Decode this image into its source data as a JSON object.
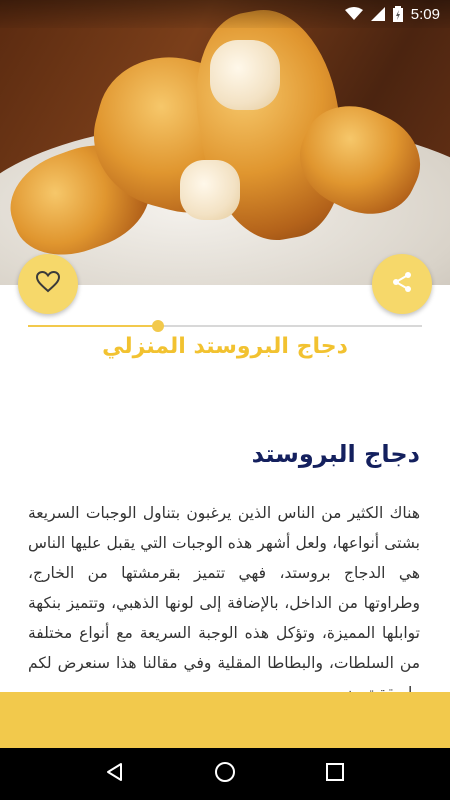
{
  "status_bar": {
    "time": "5:09",
    "icons": [
      "wifi-icon",
      "signal-icon",
      "battery-charging-icon"
    ]
  },
  "recipe": {
    "title": "دجاج البروستد المنزلي",
    "reading_progress": 0.33
  },
  "article": {
    "heading": "دجاج البروستد",
    "body": "هناك الكثير من الناس الذين يرغبون بتناول الوجبات السريعة بشتى أنواعها، ولعل أشهر هذه الوجبات التي يقبل عليها الناس هي الدجاج بروستد، فهي تتميز بقرمشتها من الخارج، وطراوتها من الداخل، بالإضافة إلى لونها الذهبي، وتتميز بنكهة توابلها المميزة، وتؤكل هذه الوجبة السريعة مع أنواع مختلفة من السلطات، والبطاطا المقلية وفي مقالنا هذا سنعرض لكم طريقة تحضير"
  },
  "actions": {
    "favorite_icon": "heart-outline-icon",
    "share_icon": "share-icon"
  },
  "navigation": {
    "back_icon": "back-triangle-icon",
    "home_icon": "home-circle-icon",
    "recents_icon": "recents-square-icon"
  },
  "colors": {
    "accent": "#f2c94c",
    "title": "#f2c230",
    "heading": "#14205e",
    "fab": "#f6d86a"
  }
}
